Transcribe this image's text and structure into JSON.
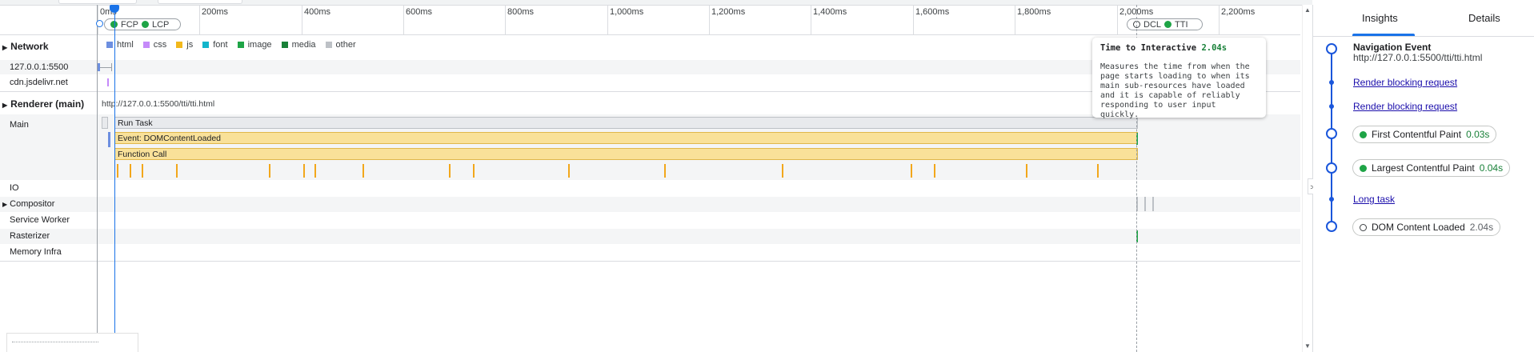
{
  "colors": {
    "accent": "#1a73e8",
    "timeline_blue": "#1a56db",
    "green_metric": "#1ea446",
    "html": "#6d8fe0",
    "css": "#c58af9",
    "js": "#f2b81b",
    "font": "#12b5cb",
    "image": "#1ea446",
    "media": "#188038",
    "other": "#bdc1c6",
    "task": "#e8eaed",
    "event": "#f9e199"
  },
  "ruler": {
    "ticks": [
      "0ms",
      "200ms",
      "400ms",
      "600ms",
      "800ms",
      "1,000ms",
      "1,200ms",
      "1,400ms",
      "1,600ms",
      "1,800ms",
      "2,000ms",
      "2,200ms"
    ],
    "markers_left": [
      {
        "label": "FCP"
      },
      {
        "label": "LCP"
      }
    ],
    "markers_right": [
      {
        "label": "DCL",
        "style": "hollow"
      },
      {
        "label": "TTI",
        "style": "green"
      }
    ]
  },
  "network": {
    "label": "Network",
    "legend": [
      {
        "label": "html",
        "color": "#6d8fe0"
      },
      {
        "label": "css",
        "color": "#c58af9"
      },
      {
        "label": "js",
        "color": "#f2b81b"
      },
      {
        "label": "font",
        "color": "#12b5cb"
      },
      {
        "label": "image",
        "color": "#1ea446"
      },
      {
        "label": "media",
        "color": "#188038"
      },
      {
        "label": "other",
        "color": "#bdc1c6"
      }
    ],
    "rows": [
      "127.0.0.1:5500",
      "cdn.jsdelivr.net"
    ]
  },
  "renderer": {
    "label": "Renderer (main)",
    "url": "http://127.0.0.1:5500/tti/tti.html",
    "main_label": "Main",
    "flame": {
      "run_task": "Run Task",
      "event": "Event: DOMContentLoaded",
      "function_call": "Function Call"
    }
  },
  "tracks": [
    "IO",
    "Compositor",
    "Service Worker",
    "Rasterizer",
    "Memory Infra"
  ],
  "tooltip": {
    "title": "Time to Interactive",
    "value": "2.04s",
    "body": "Measures the time from when the page starts loading to when its main sub-resources have loaded and it is capable of reliably responding to user input quickly."
  },
  "sidebar": {
    "tabs": [
      "Insights",
      "Details"
    ],
    "active_tab": "Insights",
    "nav_title": "Navigation Event",
    "nav_url": "http://127.0.0.1:5500/tti/tti.html",
    "items": [
      {
        "kind": "link",
        "label": "Render blocking request"
      },
      {
        "kind": "link",
        "label": "Render blocking request"
      },
      {
        "kind": "metric",
        "label": "First Contentful Paint",
        "value": "0.03s"
      },
      {
        "kind": "metric",
        "label": "Largest Contentful Paint",
        "value": "0.04s"
      },
      {
        "kind": "link",
        "label": "Long task"
      },
      {
        "kind": "metric",
        "label": "DOM Content Loaded",
        "value": "2.04s"
      }
    ]
  }
}
